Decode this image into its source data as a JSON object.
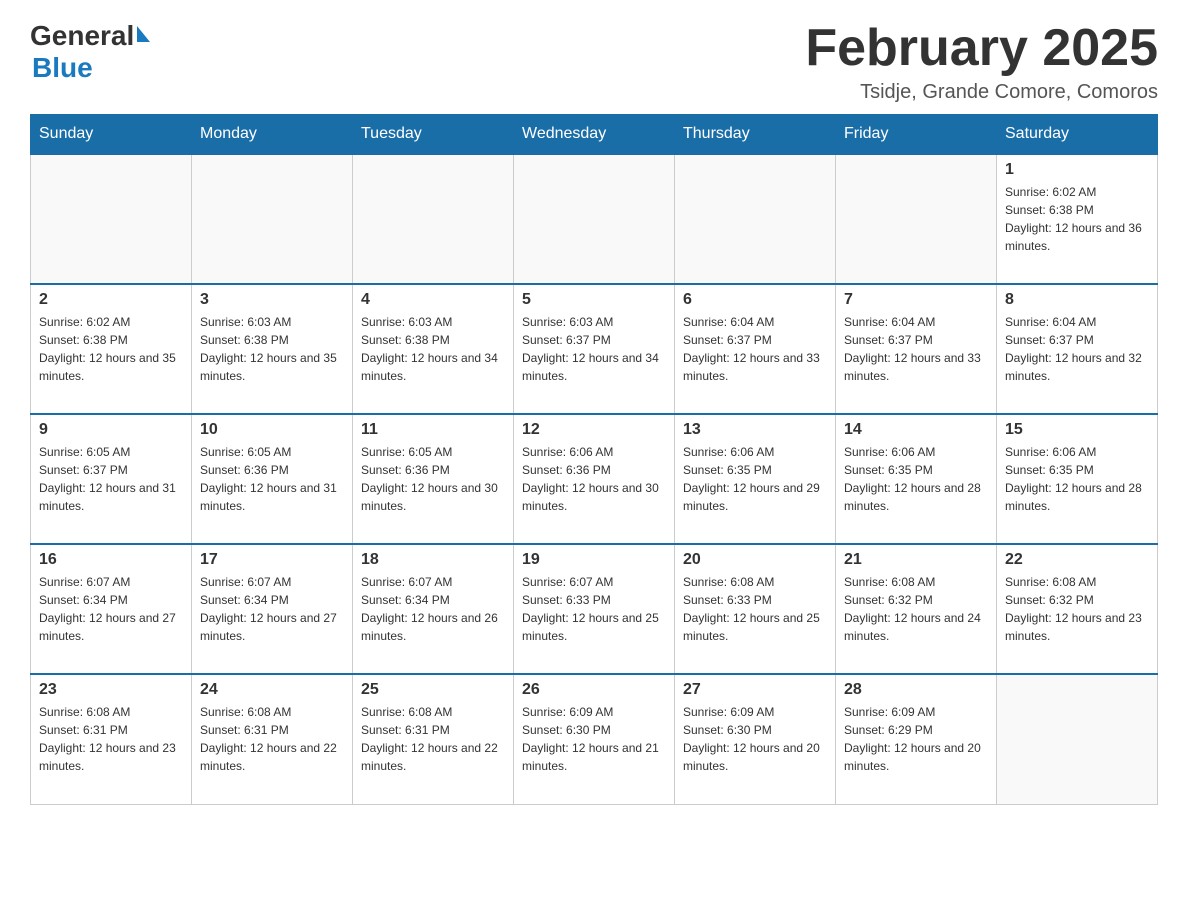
{
  "header": {
    "logo_general": "General",
    "logo_blue": "Blue",
    "month_title": "February 2025",
    "subtitle": "Tsidje, Grande Comore, Comoros"
  },
  "days_of_week": [
    "Sunday",
    "Monday",
    "Tuesday",
    "Wednesday",
    "Thursday",
    "Friday",
    "Saturday"
  ],
  "weeks": [
    {
      "days": [
        {
          "number": "",
          "sunrise": "",
          "sunset": "",
          "daylight": ""
        },
        {
          "number": "",
          "sunrise": "",
          "sunset": "",
          "daylight": ""
        },
        {
          "number": "",
          "sunrise": "",
          "sunset": "",
          "daylight": ""
        },
        {
          "number": "",
          "sunrise": "",
          "sunset": "",
          "daylight": ""
        },
        {
          "number": "",
          "sunrise": "",
          "sunset": "",
          "daylight": ""
        },
        {
          "number": "",
          "sunrise": "",
          "sunset": "",
          "daylight": ""
        },
        {
          "number": "1",
          "sunrise": "Sunrise: 6:02 AM",
          "sunset": "Sunset: 6:38 PM",
          "daylight": "Daylight: 12 hours and 36 minutes."
        }
      ]
    },
    {
      "days": [
        {
          "number": "2",
          "sunrise": "Sunrise: 6:02 AM",
          "sunset": "Sunset: 6:38 PM",
          "daylight": "Daylight: 12 hours and 35 minutes."
        },
        {
          "number": "3",
          "sunrise": "Sunrise: 6:03 AM",
          "sunset": "Sunset: 6:38 PM",
          "daylight": "Daylight: 12 hours and 35 minutes."
        },
        {
          "number": "4",
          "sunrise": "Sunrise: 6:03 AM",
          "sunset": "Sunset: 6:38 PM",
          "daylight": "Daylight: 12 hours and 34 minutes."
        },
        {
          "number": "5",
          "sunrise": "Sunrise: 6:03 AM",
          "sunset": "Sunset: 6:37 PM",
          "daylight": "Daylight: 12 hours and 34 minutes."
        },
        {
          "number": "6",
          "sunrise": "Sunrise: 6:04 AM",
          "sunset": "Sunset: 6:37 PM",
          "daylight": "Daylight: 12 hours and 33 minutes."
        },
        {
          "number": "7",
          "sunrise": "Sunrise: 6:04 AM",
          "sunset": "Sunset: 6:37 PM",
          "daylight": "Daylight: 12 hours and 33 minutes."
        },
        {
          "number": "8",
          "sunrise": "Sunrise: 6:04 AM",
          "sunset": "Sunset: 6:37 PM",
          "daylight": "Daylight: 12 hours and 32 minutes."
        }
      ]
    },
    {
      "days": [
        {
          "number": "9",
          "sunrise": "Sunrise: 6:05 AM",
          "sunset": "Sunset: 6:37 PM",
          "daylight": "Daylight: 12 hours and 31 minutes."
        },
        {
          "number": "10",
          "sunrise": "Sunrise: 6:05 AM",
          "sunset": "Sunset: 6:36 PM",
          "daylight": "Daylight: 12 hours and 31 minutes."
        },
        {
          "number": "11",
          "sunrise": "Sunrise: 6:05 AM",
          "sunset": "Sunset: 6:36 PM",
          "daylight": "Daylight: 12 hours and 30 minutes."
        },
        {
          "number": "12",
          "sunrise": "Sunrise: 6:06 AM",
          "sunset": "Sunset: 6:36 PM",
          "daylight": "Daylight: 12 hours and 30 minutes."
        },
        {
          "number": "13",
          "sunrise": "Sunrise: 6:06 AM",
          "sunset": "Sunset: 6:35 PM",
          "daylight": "Daylight: 12 hours and 29 minutes."
        },
        {
          "number": "14",
          "sunrise": "Sunrise: 6:06 AM",
          "sunset": "Sunset: 6:35 PM",
          "daylight": "Daylight: 12 hours and 28 minutes."
        },
        {
          "number": "15",
          "sunrise": "Sunrise: 6:06 AM",
          "sunset": "Sunset: 6:35 PM",
          "daylight": "Daylight: 12 hours and 28 minutes."
        }
      ]
    },
    {
      "days": [
        {
          "number": "16",
          "sunrise": "Sunrise: 6:07 AM",
          "sunset": "Sunset: 6:34 PM",
          "daylight": "Daylight: 12 hours and 27 minutes."
        },
        {
          "number": "17",
          "sunrise": "Sunrise: 6:07 AM",
          "sunset": "Sunset: 6:34 PM",
          "daylight": "Daylight: 12 hours and 27 minutes."
        },
        {
          "number": "18",
          "sunrise": "Sunrise: 6:07 AM",
          "sunset": "Sunset: 6:34 PM",
          "daylight": "Daylight: 12 hours and 26 minutes."
        },
        {
          "number": "19",
          "sunrise": "Sunrise: 6:07 AM",
          "sunset": "Sunset: 6:33 PM",
          "daylight": "Daylight: 12 hours and 25 minutes."
        },
        {
          "number": "20",
          "sunrise": "Sunrise: 6:08 AM",
          "sunset": "Sunset: 6:33 PM",
          "daylight": "Daylight: 12 hours and 25 minutes."
        },
        {
          "number": "21",
          "sunrise": "Sunrise: 6:08 AM",
          "sunset": "Sunset: 6:32 PM",
          "daylight": "Daylight: 12 hours and 24 minutes."
        },
        {
          "number": "22",
          "sunrise": "Sunrise: 6:08 AM",
          "sunset": "Sunset: 6:32 PM",
          "daylight": "Daylight: 12 hours and 23 minutes."
        }
      ]
    },
    {
      "days": [
        {
          "number": "23",
          "sunrise": "Sunrise: 6:08 AM",
          "sunset": "Sunset: 6:31 PM",
          "daylight": "Daylight: 12 hours and 23 minutes."
        },
        {
          "number": "24",
          "sunrise": "Sunrise: 6:08 AM",
          "sunset": "Sunset: 6:31 PM",
          "daylight": "Daylight: 12 hours and 22 minutes."
        },
        {
          "number": "25",
          "sunrise": "Sunrise: 6:08 AM",
          "sunset": "Sunset: 6:31 PM",
          "daylight": "Daylight: 12 hours and 22 minutes."
        },
        {
          "number": "26",
          "sunrise": "Sunrise: 6:09 AM",
          "sunset": "Sunset: 6:30 PM",
          "daylight": "Daylight: 12 hours and 21 minutes."
        },
        {
          "number": "27",
          "sunrise": "Sunrise: 6:09 AM",
          "sunset": "Sunset: 6:30 PM",
          "daylight": "Daylight: 12 hours and 20 minutes."
        },
        {
          "number": "28",
          "sunrise": "Sunrise: 6:09 AM",
          "sunset": "Sunset: 6:29 PM",
          "daylight": "Daylight: 12 hours and 20 minutes."
        },
        {
          "number": "",
          "sunrise": "",
          "sunset": "",
          "daylight": ""
        }
      ]
    }
  ]
}
